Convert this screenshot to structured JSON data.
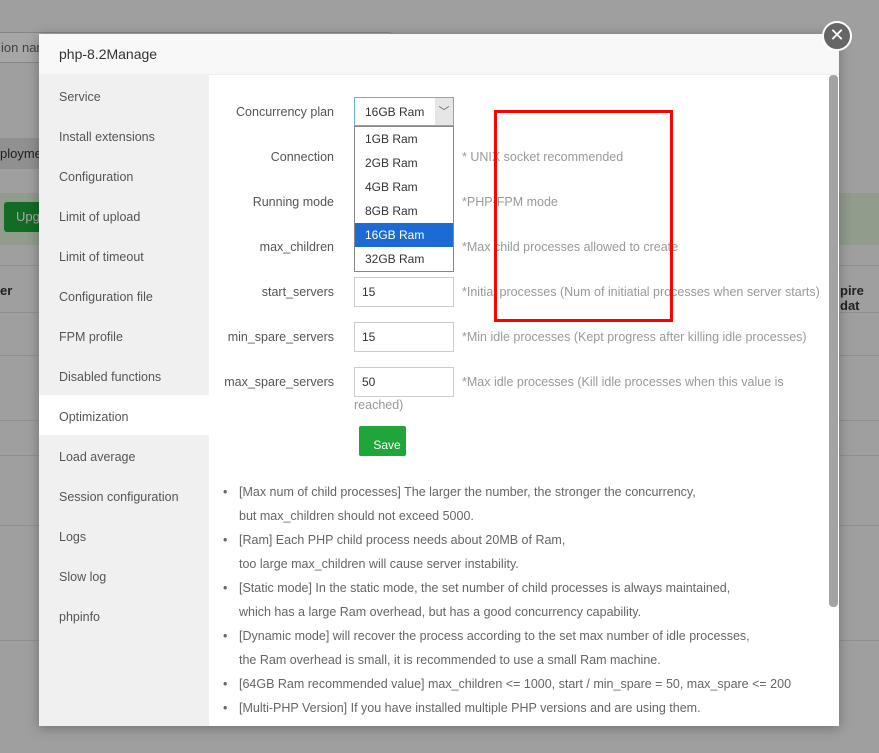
{
  "background": {
    "search_fragment": "ion nam",
    "tab_fragment": "ploymer",
    "upgrade_fragment": "Upg",
    "col_left_fragment": "er",
    "col_right_fragment": "pire dat"
  },
  "modal": {
    "title": "php-8.2Manage",
    "close_icon": "close-icon"
  },
  "sidebar": {
    "items": [
      {
        "label": "Service"
      },
      {
        "label": "Install extensions"
      },
      {
        "label": "Configuration"
      },
      {
        "label": "Limit of upload"
      },
      {
        "label": "Limit of timeout"
      },
      {
        "label": "Configuration file"
      },
      {
        "label": "FPM profile"
      },
      {
        "label": "Disabled functions"
      },
      {
        "label": "Optimization",
        "active": true
      },
      {
        "label": "Load average"
      },
      {
        "label": "Session configuration"
      },
      {
        "label": "Logs"
      },
      {
        "label": "Slow log"
      },
      {
        "label": "phpinfo"
      }
    ]
  },
  "form": {
    "concurrency": {
      "label": "Concurrency plan",
      "value": "16GB Ram",
      "options": [
        "1GB Ram",
        "2GB Ram",
        "4GB Ram",
        "8GB Ram",
        "16GB Ram",
        "32GB Ram"
      ]
    },
    "connection": {
      "label": "Connection",
      "hint": "* UNIX socket recommended"
    },
    "running_mode": {
      "label": "Running mode",
      "hint": "*PHP-FPM mode"
    },
    "max_children": {
      "label": "max_children",
      "hint": "*Max child processes allowed to create"
    },
    "start_servers": {
      "label": "start_servers",
      "value": "15",
      "hint": "*Initial processes (Num of initiatial processes when server starts)"
    },
    "min_spare_servers": {
      "label": "min_spare_servers",
      "value": "15",
      "hint": "*Min idle processes (Kept progress after killing idle processes)"
    },
    "max_spare_servers": {
      "label": "max_spare_servers",
      "value": "50",
      "hint": "*Max idle processes (Kill idle processes when this value is",
      "hint2": "reached)"
    },
    "save_label": "Save"
  },
  "notes": [
    "[Max num of child processes] The larger the number, the stronger the concurrency,",
    "but max_children should not exceed 5000.",
    "[Ram] Each PHP child process needs about 20MB of Ram,",
    "too large max_children will cause server instability.",
    "[Static mode] In the static mode, the set number of child processes is always maintained,",
    "which has a large Ram overhead, but has a good concurrency capability.",
    "[Dynamic mode] will recover the process according to the set max number of idle processes,",
    "the Ram overhead is small, it is recommended to use a small Ram machine.",
    "[64GB Ram recommended value] max_children <= 1000, start / min_spare = 50, max_spare <= 200",
    "[Multi-PHP Version] If you have installed multiple PHP versions and are using them."
  ]
}
